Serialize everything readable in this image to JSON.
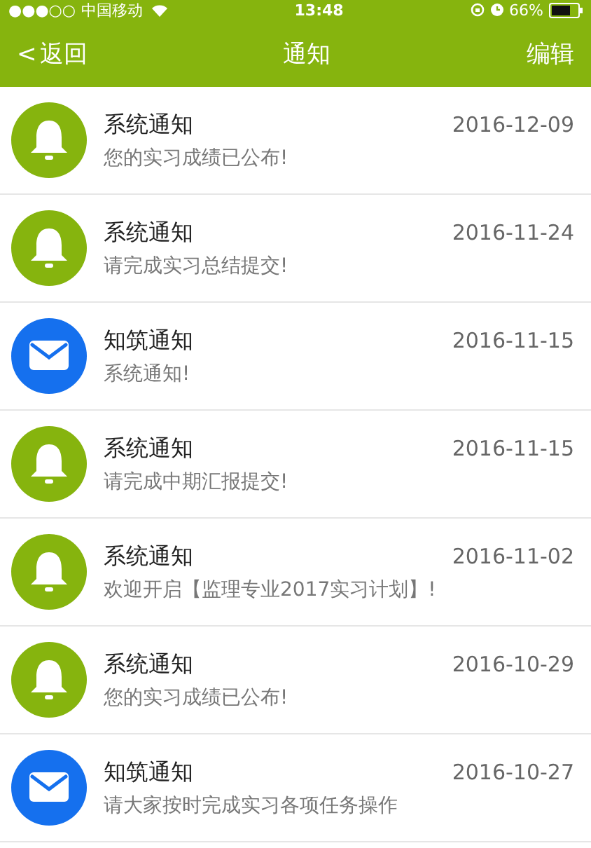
{
  "status_bar": {
    "signal": "●●●○○",
    "carrier": "中国移动",
    "time": "13:48",
    "battery": "66%"
  },
  "nav": {
    "back": "返回",
    "back_glyph": "<",
    "title": "通知",
    "action": "编辑"
  },
  "notifications": [
    {
      "kind": "system",
      "title": "系统通知",
      "date": "2016-12-09",
      "message": "您的实习成绩已公布!"
    },
    {
      "kind": "system",
      "title": "系统通知",
      "date": "2016-11-24",
      "message": "请完成实习总结提交!"
    },
    {
      "kind": "mail",
      "title": "知筑通知",
      "date": "2016-11-15",
      "message": "系统通知!"
    },
    {
      "kind": "system",
      "title": "系统通知",
      "date": "2016-11-15",
      "message": "请完成中期汇报提交!"
    },
    {
      "kind": "system",
      "title": "系统通知",
      "date": "2016-11-02",
      "message": "欢迎开启【监理专业2017实习计划】!"
    },
    {
      "kind": "system",
      "title": "系统通知",
      "date": "2016-10-29",
      "message": "您的实习成绩已公布!"
    },
    {
      "kind": "mail",
      "title": "知筑通知",
      "date": "2016-10-27",
      "message": "请大家按时完成实习各项任务操作"
    }
  ]
}
